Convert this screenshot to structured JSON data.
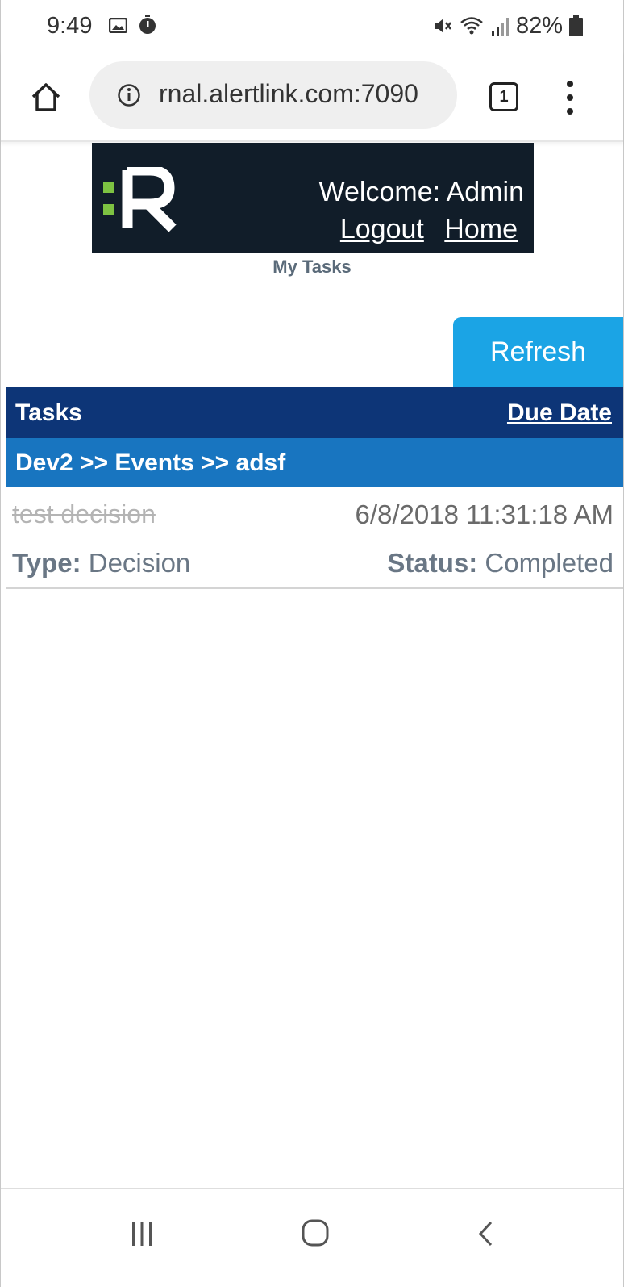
{
  "status_bar": {
    "time": "9:49",
    "battery": "82%",
    "icons": [
      "gallery-icon",
      "timer-icon",
      "mute-icon",
      "wifi-icon",
      "signal-icon",
      "battery-icon"
    ]
  },
  "browser": {
    "url": "rnal.alertlink.com:7090",
    "tab_count": "1",
    "icons": [
      "home-icon",
      "info-icon",
      "tabs-icon",
      "menu-icon"
    ]
  },
  "banner": {
    "welcome": "Welcome: Admin",
    "logout_label": "Logout",
    "home_label": "Home",
    "colors": {
      "background": "#111d29",
      "logo_accent": "#7dc242"
    }
  },
  "page_title": "My Tasks",
  "refresh_label": "Refresh",
  "tasks_table": {
    "header_tasks": "Tasks",
    "header_due": "Due Date",
    "group": "Dev2 >> Events >> adsf",
    "rows": [
      {
        "name": "test decision",
        "due": "6/8/2018 11:31:18 AM",
        "type_label": "Type:",
        "type_value": " Decision",
        "status_label": "Status:",
        "status_value": " Completed"
      }
    ],
    "colors": {
      "header": "#0d3577",
      "group": "#1875c0",
      "refresh": "#1ba4e5"
    }
  },
  "nav_bar": {
    "icons": [
      "recents-icon",
      "nav-home-icon",
      "back-icon"
    ]
  }
}
